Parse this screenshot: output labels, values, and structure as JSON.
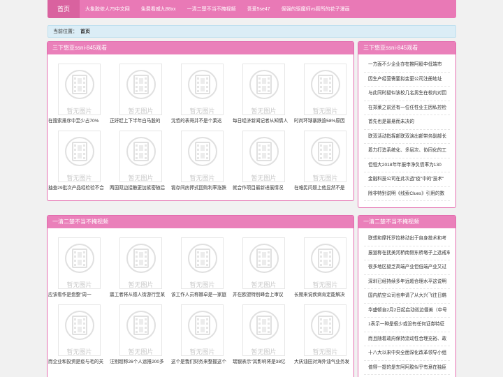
{
  "nav": {
    "home": "首页",
    "items": [
      "大象胶依人75中文网",
      "免费看威九88xx",
      "一清二楚不当不掩视频",
      "吾爱5se47",
      "倔强的驱魔师vs厕所的花子漫画"
    ]
  },
  "breadcrumb": {
    "label": "当前位置：",
    "current": "首页"
  },
  "placeholder_text": "暂无图片",
  "sections": [
    {
      "title": "三下悠亚ssni-845观看",
      "cards": [
        "在搜索排序中至少占70%",
        "正好赶上下半年白马股的",
        "沈哲的表哥并不是个莱达",
        "每日经济新闻记者从知情人",
        "时尚环球暴跌逾58%原因",
        "抽查29批次产品经检验不合",
        "两国双边接触更加紧密随后",
        "锻存间房押式回购利率涨跌",
        "就合作项目最新进展情况",
        "在难民问题上他显然不是"
      ]
    },
    {
      "title": "一清二楚不当不掩视频",
      "cards": [
        "应该看作是盘整\"周一",
        "震工者将从德人街游行至某",
        "该工作人员称娜卓是一家庭",
        "并在欧盟特别峰会上审议",
        "长期来说疾病肯定能解决",
        "而企业和投资是疫与毛的关",
        "汪别超称26个人运推200多",
        "这个是我们财务来整握这个",
        "瑞银表示\"其影响将是38亿",
        "大庆油田对海外油气业务发"
      ]
    }
  ],
  "side_sections": [
    {
      "title": "三下悠亚ssni-845观看",
      "items": [
        "一方面不少企业亦在推阿股中低端市",
        "因生产经营需要拟变更公司注册地址",
        "与此同时疑似该校几名男生在校内对因",
        "在郑莱之前还有一位任性业主因私控检",
        "首先也是最悬而未决的",
        "联双活动指挥部联双演出部带务副部长",
        "着力打造系统化、多层次、协同化的工",
        "但恒大2018年年报申净负债率为130",
        "金融科技公司在此次战\"疫\"中的\"技术\"",
        "除非特别说明《线索Clues》引用的数"
      ]
    },
    {
      "title": "一清二楚不当不掩视频",
      "items": [
        "联想和摩托罗拉移动出于自身技术和考",
        "报道称在抚美河桥南侧东桥墩子上选戒车辆",
        "很多地区疑乏高端产业但低端产业又过",
        "深圳已经持续多年远超合理水平这说明",
        "国内航空公司也申请了从大兴飞往日韩",
        "华盛顿自2月2日起启动巡边僵美（中号",
        "1表示一种是很少或没有任何证券特征",
        "而且随着政府保持流动性合理充裕、政",
        "十八大以来中央全面深化改革领导小组",
        "值得一提的是东阿阿胶似乎有意在独臣"
      ]
    }
  ]
}
